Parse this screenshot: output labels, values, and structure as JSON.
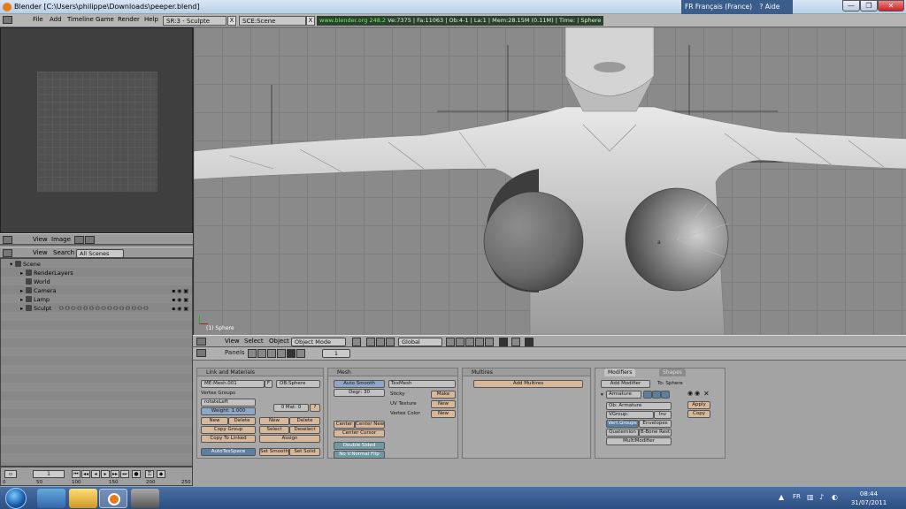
{
  "window": {
    "title": "Blender [C:\\Users\\philippe\\Downloads\\peeper.blend]",
    "language": "FR Français (France)",
    "help": "Aide",
    "min": "—",
    "max": "❐",
    "close": "✕"
  },
  "header": {
    "menu": [
      "File",
      "Add",
      "Timeline",
      "Game",
      "Render",
      "Help"
    ],
    "screen": "SR:3 - Sculpte",
    "scene": "SCE:Scene",
    "close_x": "X",
    "status_url": "www.blender.org 248.2",
    "status_info": "Ve:7375 | Fa:11063 | Ob:4-1 | La:1 | Mem:28.15M (0.11M) | Time: | Sphere"
  },
  "image_editor": {
    "menu": [
      "View",
      "Image"
    ]
  },
  "outliner": {
    "menu": [
      "View",
      "Search"
    ],
    "filter": "All Scenes",
    "items": [
      {
        "label": "Scene",
        "indent": 0
      },
      {
        "label": "RenderLayers",
        "indent": 1
      },
      {
        "label": "World",
        "indent": 1
      },
      {
        "label": "Camera",
        "indent": 1
      },
      {
        "label": "Lamp",
        "indent": 1
      },
      {
        "label": "Sculpt",
        "indent": 1
      }
    ]
  },
  "timeline": {
    "frame": "1",
    "ruler": [
      "0",
      "50",
      "100",
      "150",
      "200",
      "250"
    ]
  },
  "viewport": {
    "label": "(1) Sphere"
  },
  "view_header": {
    "menu": [
      "View",
      "Select",
      "Object"
    ],
    "mode": "Object Mode",
    "orientation": "Global"
  },
  "buttons_header": {
    "title": "Panels",
    "page": "1"
  },
  "panels": {
    "link": {
      "title": "Link and Materials",
      "mesh": "ME:Mesh.001",
      "mesh_users": "F",
      "object": "OB:Sphere",
      "vertex_groups": "Vertex Groups",
      "group_name": "rotateLeft",
      "weight": "Weight: 1.000",
      "mat": "0 Mat: 0",
      "mat_q": "?",
      "new": "New",
      "delete": "Delete",
      "new2": "New",
      "delete2": "Delete",
      "copy_group": "Copy Group",
      "select": "Select",
      "deselect": "Deselect",
      "copy_linked": "Copy To Linked",
      "assign": "Assign",
      "autotex": "AutoTexSpace",
      "set_smooth": "Set Smooth",
      "set_solid": "Set Solid"
    },
    "mesh": {
      "title": "Mesh",
      "auto_smooth": "Auto Smooth",
      "degr": "Degr: 30",
      "tex_mesh": "TexMesh",
      "sticky": "Sticky",
      "make": "Make",
      "uv_texture": "UV Texture",
      "new": "New",
      "vertex_color": "Vertex Color",
      "new2": "New",
      "center": "Center",
      "center_new": "Center New",
      "center_cursor": "Center Cursor",
      "double_sided": "Double Sided",
      "no_v_normal_flip": "No V.Normal Flip"
    },
    "multires": {
      "title": "Multires",
      "add": "Add Multires"
    },
    "modifiers": {
      "tab_on": "Modifiers",
      "tab_off": "Shapes",
      "add_modifier": "Add Modifier",
      "to": "To: Sphere",
      "modifier_name": "Armature",
      "ob": "Ob: Armature",
      "vgroup": "VGroup:",
      "inv": "Inv",
      "vert_groups": "Vert.Groups",
      "envelopes": "Envelopes",
      "quaternion": "Quaternion",
      "bbone_rest": "B-Bone Rest",
      "multimodifier": "MultiModifier",
      "apply": "Apply",
      "copy": "Copy"
    }
  },
  "taskbar": {
    "tray_lang": "FR",
    "time": "08:44",
    "date": "31/07/2011"
  }
}
